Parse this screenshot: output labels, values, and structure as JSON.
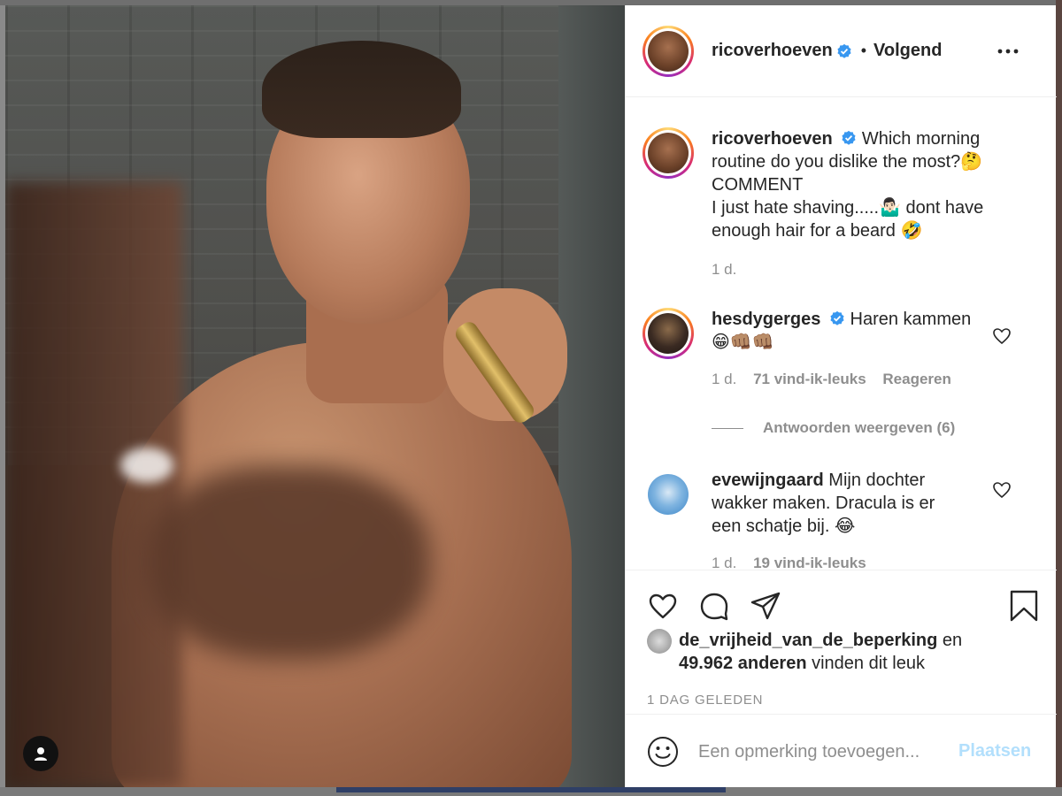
{
  "post": {
    "author": "ricoverhoeven",
    "follow_status": "Volgend",
    "dot": "•",
    "more_icon": "more-icon"
  },
  "caption": {
    "username": "ricoverhoeven",
    "text_line1": "Which morning",
    "text_line2": "routine do you dislike the most?🤔",
    "text_line3": "COMMENT",
    "text_line4": "I just hate shaving.....🤷🏻‍♂️ dont have",
    "text_line5": "enough hair for a beard 🤣",
    "time": "1 d."
  },
  "comments": [
    {
      "username": "hesdygerges",
      "text": "Haren kammen",
      "emoji": "😁👊🏽👊🏽",
      "time": "1 d.",
      "likes": "71 vind-ik-leuks",
      "reply": "Reageren",
      "view_replies": "Antwoorden weergeven (6)"
    },
    {
      "username": "evewijngaard",
      "text_line1": "Mijn dochter",
      "text_line2": "wakker maken. Dracula is er",
      "text_line3": "een schatje bij. 😂",
      "time": "1 d.",
      "likes": "19 vind-ik-leuks"
    }
  ],
  "likes": {
    "liker": "de_vrijheid_van_de_beperking",
    "connector": "en",
    "others": "49.962 anderen",
    "suffix": "vinden dit leuk"
  },
  "timestamp": "1 DAG GELEDEN",
  "add_comment": {
    "placeholder": "Een opmerking toevoegen...",
    "post_label": "Plaatsen"
  },
  "colors": {
    "verified": "#3897f0",
    "post_disabled": "#b2dffc",
    "meta": "#8e8e8e"
  }
}
